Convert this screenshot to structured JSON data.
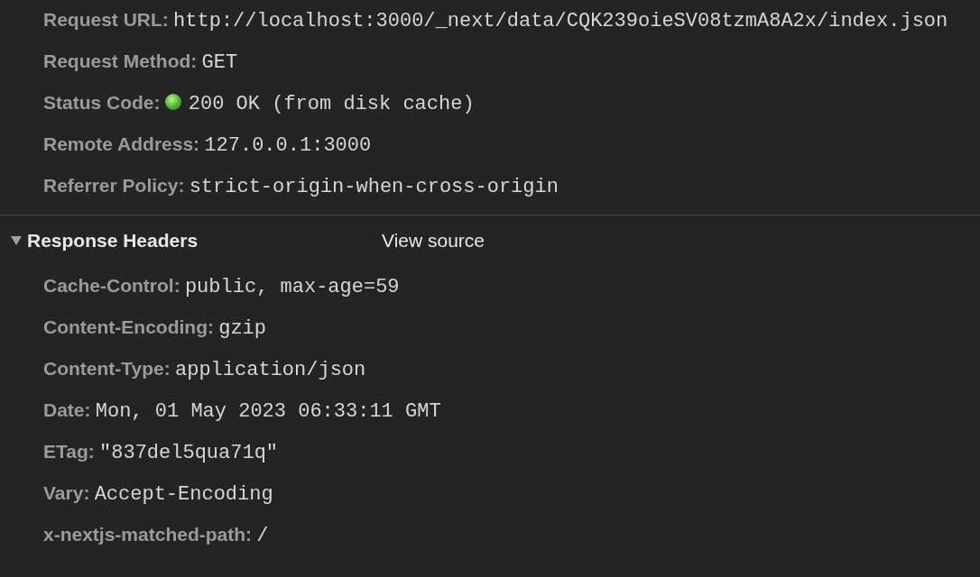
{
  "general": {
    "rows": [
      {
        "kind": "text",
        "name": "Request URL:",
        "value": "http://localhost:3000/_next/data/CQK239oieSV08tzmA8A2x/index.json"
      },
      {
        "kind": "text",
        "name": "Request Method:",
        "value": "GET"
      },
      {
        "kind": "status",
        "name": "Status Code:",
        "value": "200 OK (from disk cache)"
      },
      {
        "kind": "text",
        "name": "Remote Address:",
        "value": "127.0.0.1:3000"
      },
      {
        "kind": "text",
        "name": "Referrer Policy:",
        "value": "strict-origin-when-cross-origin"
      }
    ]
  },
  "response_headers": {
    "title": "Response Headers",
    "expanded": true,
    "view_source": "View source",
    "rows": [
      {
        "name": "Cache-Control:",
        "value": "public, max-age=59"
      },
      {
        "name": "Content-Encoding:",
        "value": "gzip"
      },
      {
        "name": "Content-Type:",
        "value": "application/json"
      },
      {
        "name": "Date:",
        "value": "Mon, 01 May 2023 06:33:11 GMT"
      },
      {
        "name": "ETag:",
        "value": "\"837del5qua71q\""
      },
      {
        "name": "Vary:",
        "value": "Accept-Encoding"
      },
      {
        "name": "x-nextjs-matched-path:",
        "value": "/"
      }
    ]
  }
}
